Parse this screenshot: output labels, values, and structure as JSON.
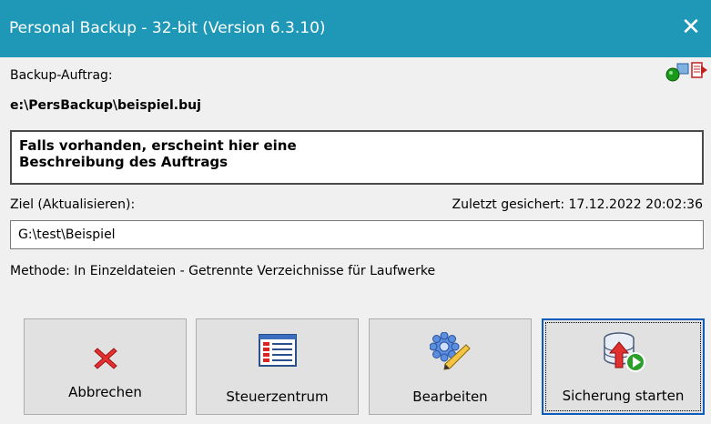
{
  "window": {
    "title": "Personal Backup - 32-bit (Version 6.3.10)",
    "close_glyph": "✕",
    "titlebar_color": "#1e98b6"
  },
  "job": {
    "label": "Backup-Auftrag:",
    "path": "e:\\PersBackup\\beispiel.buj",
    "description_lines": [
      "Falls vorhanden, erscheint hier eine",
      "Beschreibung des Auftrags"
    ]
  },
  "target": {
    "label": "Ziel (Aktualisieren):",
    "last_saved": "Zuletzt gesichert: 17.12.2022 20:02:36",
    "path": "G:\\test\\Beispiel"
  },
  "method": "Methode: In Einzeldateien - Getrennte Verzeichnisse für Laufwerke",
  "buttons": {
    "cancel": "Abbrechen",
    "control_center": "Steuerzentrum",
    "edit": "Bearbeiten",
    "start": "Sicherung starten"
  },
  "icons": {
    "status": "job-status-icon",
    "cancel": "red-x-icon",
    "control_center": "control-panel-icon",
    "edit": "gear-pencil-icon",
    "start": "database-upload-play-icon"
  }
}
